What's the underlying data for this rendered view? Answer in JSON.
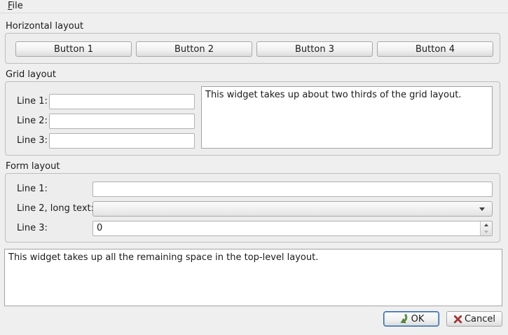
{
  "menubar": {
    "items": [
      {
        "label": "File",
        "mnemonic": "F",
        "rest": "ile"
      }
    ]
  },
  "groups": {
    "horizontal": {
      "title": "Horizontal layout",
      "buttons": [
        "Button 1",
        "Button 2",
        "Button 3",
        "Button 4"
      ]
    },
    "grid": {
      "title": "Grid layout",
      "rows": [
        {
          "label": "Line 1:",
          "value": ""
        },
        {
          "label": "Line 2:",
          "value": ""
        },
        {
          "label": "Line 3:",
          "value": ""
        }
      ],
      "textedit": "This widget takes up about two thirds of the grid layout."
    },
    "form": {
      "title": "Form layout",
      "line1": {
        "label": "Line 1:",
        "value": ""
      },
      "line2": {
        "label": "Line 2, long text:",
        "value": ""
      },
      "line3": {
        "label": "Line 3:",
        "value": "0"
      }
    }
  },
  "bottom_textedit": "This widget takes up all the remaining space in the top-level layout.",
  "dialog_buttons": {
    "ok": "OK",
    "cancel": "Cancel"
  },
  "colors": {
    "window_bg": "#efefef",
    "focus_border_blue": "#2a659f",
    "ok_icon_green": "#5c8f41",
    "cancel_icon_red": "#a23535"
  }
}
